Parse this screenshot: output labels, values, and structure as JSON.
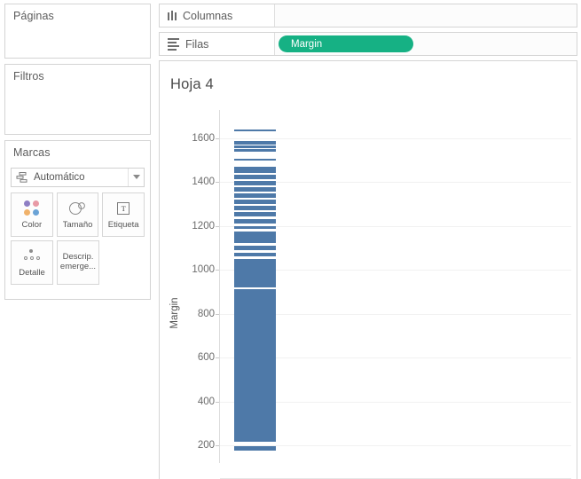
{
  "left_panel": {
    "pages": {
      "title": "Páginas"
    },
    "filters": {
      "title": "Filtros"
    },
    "marks": {
      "title": "Marcas",
      "mark_type": "Automático",
      "mark_type_icon": "mark-type-automatic-icon",
      "caret_icon": "chevron-down-icon",
      "buttons": [
        {
          "label": "Color",
          "icon": "color-dots-icon"
        },
        {
          "label": "Tamaño",
          "icon": "size-circles-icon"
        },
        {
          "label": "Etiqueta",
          "icon": "label-text-icon"
        },
        {
          "label": "Detalle",
          "icon": "detail-dots-icon"
        },
        {
          "label": "Descrip. emerge...",
          "icon": "tooltip-icon"
        }
      ]
    }
  },
  "shelves": {
    "columns": {
      "label": "Columnas",
      "icon": "columns-icon",
      "pills": []
    },
    "rows": {
      "label": "Filas",
      "icon": "rows-icon",
      "pills": [
        {
          "text": "Margin",
          "color": "#16b184"
        }
      ]
    }
  },
  "worksheet": {
    "title": "Hoja 4"
  },
  "chart_data": {
    "type": "bar",
    "title": "Hoja 4",
    "xlabel": "",
    "ylabel": "Margin",
    "ylim": [
      100,
      1700
    ],
    "yticks": [
      1600,
      1400,
      1200,
      1000,
      800,
      600,
      400,
      200
    ],
    "grid": true,
    "legend": "none",
    "mark_color": "#4e79a8",
    "orientation": "vertical-single-column",
    "description": "Single vertical column of stacked Gantt-style bar marks for the measure Margin; marks are dense and merge into solid blocks at lower values.",
    "categories": [
      "Margin"
    ],
    "values": [
      1640
    ],
    "marks": [
      {
        "top": 1640,
        "bottom": 1630
      },
      {
        "top": 1585,
        "bottom": 1572
      },
      {
        "top": 1568,
        "bottom": 1556
      },
      {
        "top": 1552,
        "bottom": 1540
      },
      {
        "top": 1508,
        "bottom": 1496
      },
      {
        "top": 1470,
        "bottom": 1440
      },
      {
        "top": 1432,
        "bottom": 1414
      },
      {
        "top": 1406,
        "bottom": 1386
      },
      {
        "top": 1378,
        "bottom": 1358
      },
      {
        "top": 1350,
        "bottom": 1330
      },
      {
        "top": 1320,
        "bottom": 1300
      },
      {
        "top": 1292,
        "bottom": 1272
      },
      {
        "top": 1262,
        "bottom": 1242
      },
      {
        "top": 1230,
        "bottom": 1212
      },
      {
        "top": 1198,
        "bottom": 1186
      },
      {
        "top": 1176,
        "bottom": 1124
      },
      {
        "top": 1112,
        "bottom": 1090
      },
      {
        "top": 1078,
        "bottom": 1062
      },
      {
        "top": 1050,
        "bottom": 920
      },
      {
        "top": 912,
        "bottom": 218
      },
      {
        "top": 196,
        "bottom": 178
      }
    ]
  }
}
